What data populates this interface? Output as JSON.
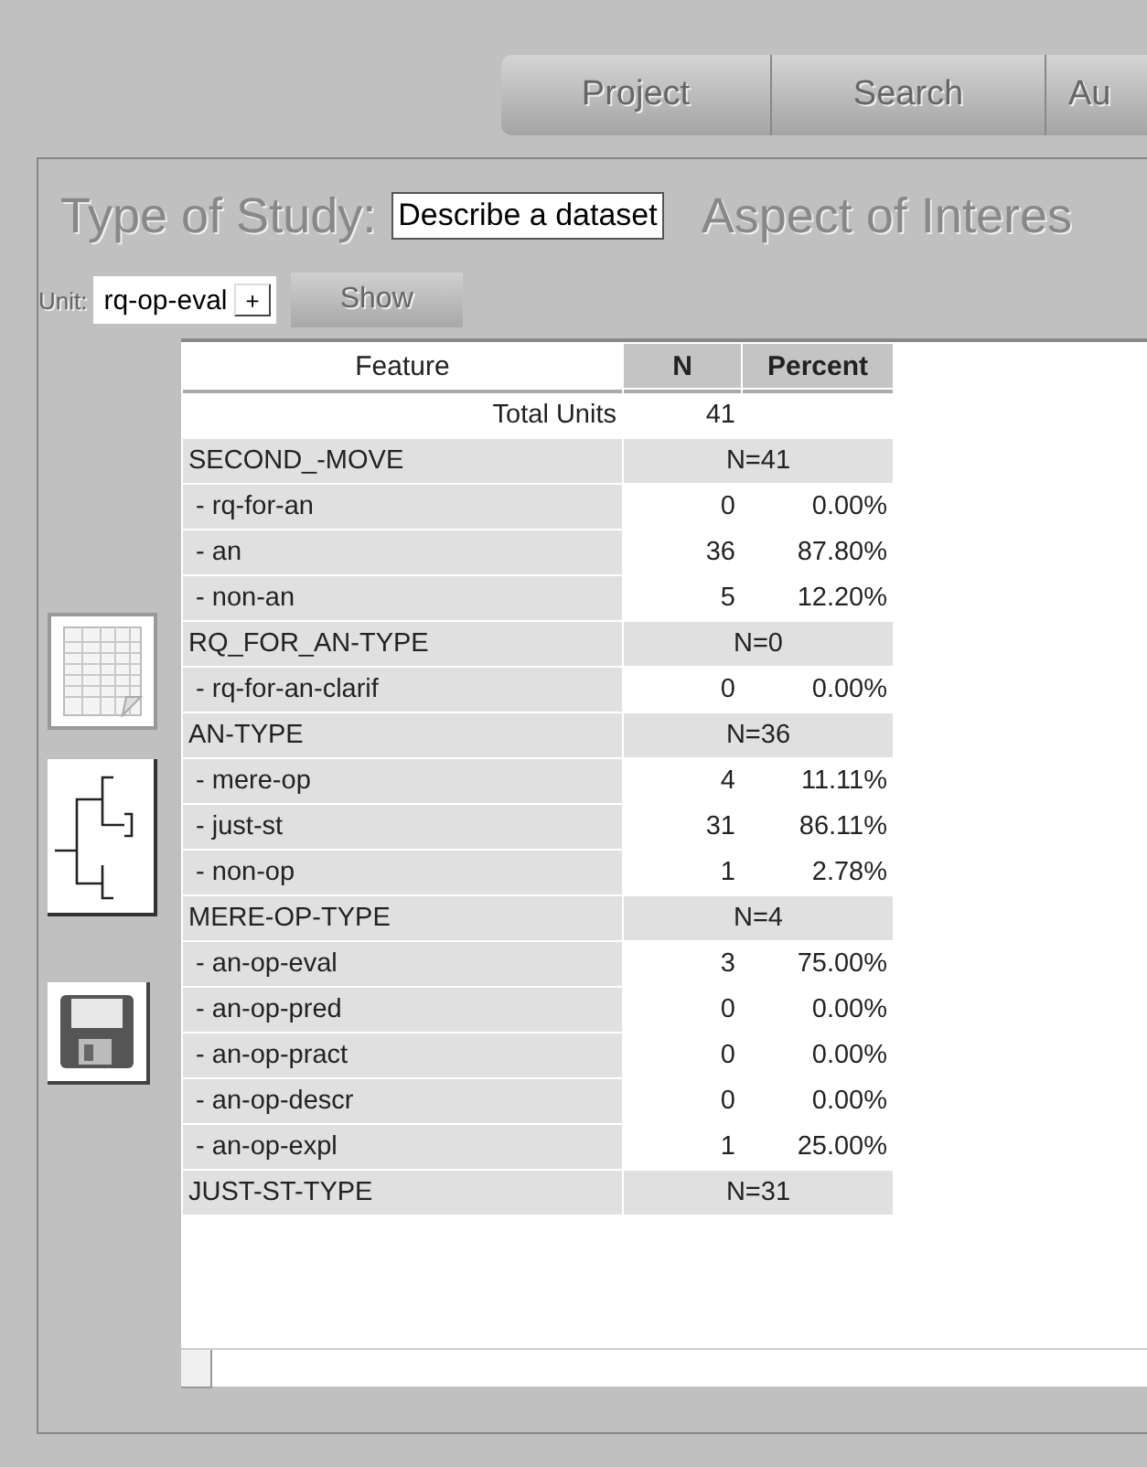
{
  "tabs": [
    {
      "label": "Project"
    },
    {
      "label": "Search"
    },
    {
      "label": "Au"
    }
  ],
  "study": {
    "label": "Type of Study:",
    "value": "Describe a dataset",
    "aspect_label": "Aspect of Interes"
  },
  "unit": {
    "label": "Unit:",
    "value": "rq-op-eval",
    "add": "+",
    "show": "Show"
  },
  "table": {
    "columns": [
      "Feature",
      "N",
      "Percent"
    ],
    "rows": [
      {
        "kind": "total",
        "feature": "Total Units",
        "n": "41"
      },
      {
        "kind": "group",
        "feature": "SECOND_-MOVE",
        "n": "N=41"
      },
      {
        "kind": "item",
        "feature": " - rq-for-an",
        "n": "0",
        "percent": "0.00%"
      },
      {
        "kind": "item",
        "feature": " - an",
        "n": "36",
        "percent": "87.80%"
      },
      {
        "kind": "item",
        "feature": " - non-an",
        "n": "5",
        "percent": "12.20%"
      },
      {
        "kind": "group",
        "feature": "RQ_FOR_AN-TYPE",
        "n": "N=0"
      },
      {
        "kind": "item",
        "feature": " - rq-for-an-clarif",
        "n": "0",
        "percent": "0.00%"
      },
      {
        "kind": "group",
        "feature": "AN-TYPE",
        "n": "N=36"
      },
      {
        "kind": "item",
        "feature": " - mere-op",
        "n": "4",
        "percent": "11.11%"
      },
      {
        "kind": "item",
        "feature": " - just-st",
        "n": "31",
        "percent": "86.11%"
      },
      {
        "kind": "item",
        "feature": " - non-op",
        "n": "1",
        "percent": "2.78%"
      },
      {
        "kind": "group",
        "feature": "MERE-OP-TYPE",
        "n": "N=4"
      },
      {
        "kind": "item",
        "feature": " - an-op-eval",
        "n": "3",
        "percent": "75.00%"
      },
      {
        "kind": "item",
        "feature": " - an-op-pred",
        "n": "0",
        "percent": "0.00%"
      },
      {
        "kind": "item",
        "feature": " - an-op-pract",
        "n": "0",
        "percent": "0.00%"
      },
      {
        "kind": "item",
        "feature": " - an-op-descr",
        "n": "0",
        "percent": "0.00%"
      },
      {
        "kind": "item",
        "feature": " - an-op-expl",
        "n": "1",
        "percent": "25.00%"
      },
      {
        "kind": "group",
        "feature": "JUST-ST-TYPE",
        "n": "N=31"
      }
    ]
  }
}
